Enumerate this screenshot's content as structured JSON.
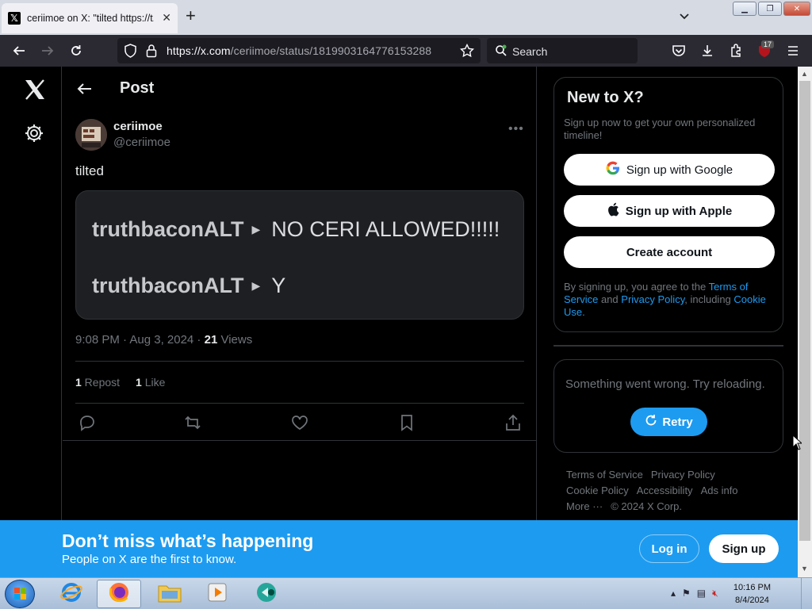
{
  "browser": {
    "tab_title": "ceriimoe on X: \"tilted https://t.co",
    "tab_favicon": "𝕏",
    "url_main": "https://x.com",
    "url_path": "/ceriimoe/status/1819903164776153288",
    "search_placeholder": "Search",
    "extension_badge": "17"
  },
  "sidebar_nav": {
    "logo": "x-logo",
    "settings": "gear-icon"
  },
  "post": {
    "heading": "Post",
    "author_name": "ceriimoe",
    "author_handle": "@ceriimoe",
    "text": "tilted",
    "media_lines": [
      {
        "user": "truthbaconALT",
        "message": "NO CERI ALLOWED!!!!!"
      },
      {
        "user": "truthbaconALT",
        "message": "Y"
      }
    ],
    "time": "9:08 PM · Aug 3, 2024 · ",
    "views_count": "21",
    "views_label": " Views",
    "reposts_count": "1",
    "reposts_label": " Repost",
    "likes_count": "1",
    "likes_label": " Like"
  },
  "signup_card": {
    "title": "New to X?",
    "subtitle": "Sign up now to get your own personalized timeline!",
    "google_label": "Sign up with Google",
    "apple_label": "Sign up with Apple",
    "create_label": "Create account",
    "legal_prefix": "By signing up, you agree to the ",
    "terms_link": "Terms of Service",
    "legal_and": " and ",
    "privacy_link": "Privacy Policy",
    "legal_including": ", including ",
    "cookie_link": "Cookie Use",
    "legal_end": "."
  },
  "error_card": {
    "message": "Something went wrong. Try reloading.",
    "retry_label": "Retry"
  },
  "footer": {
    "links": [
      "Terms of Service",
      "Privacy Policy",
      "Cookie Policy",
      "Accessibility",
      "Ads info",
      "More ···",
      "© 2024 X Corp."
    ]
  },
  "banner": {
    "title": "Don’t miss what’s happening",
    "subtitle": "People on X are the first to know.",
    "login_label": "Log in",
    "signup_label": "Sign up"
  },
  "taskbar": {
    "time": "10:16 PM",
    "date": "8/4/2024"
  },
  "colors": {
    "accent": "#1d9bf0",
    "text_primary": "#e7e9ea",
    "text_secondary": "#71767b",
    "border": "#2f3336"
  }
}
